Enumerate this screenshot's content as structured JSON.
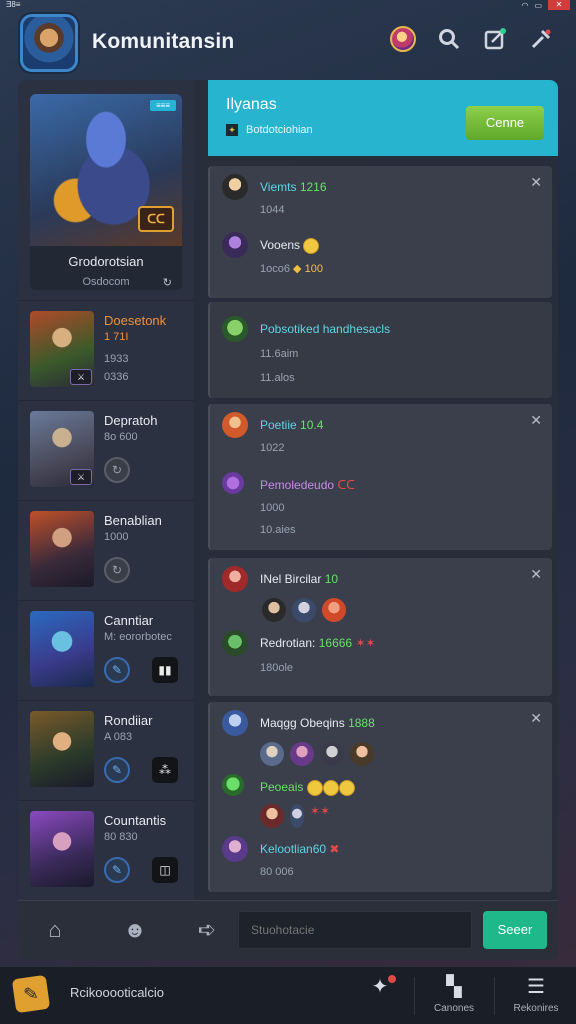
{
  "statusbar": {
    "left": "Ǝ8≡",
    "close": "✕"
  },
  "app": {
    "title": "Komunitansin"
  },
  "feature": {
    "tag": "≡≡≡",
    "badge": "ᑕᑕ",
    "name": "Grodorotsian",
    "sub": "Osdocom"
  },
  "heroes": [
    {
      "name": "Doesetonk",
      "line1": "1 71I",
      "line2": "1933",
      "line3": "0336",
      "mini": "⚔"
    },
    {
      "name": "Depratoh",
      "line1": "8o 600",
      "mini": "⚔"
    },
    {
      "name": "Benablian",
      "line1": "1000"
    },
    {
      "name": "Canntiar",
      "line1": "M: eororbotec"
    },
    {
      "name": "Rondiiar",
      "line1": "A 083"
    },
    {
      "name": "Countantis",
      "line1": "80 830"
    }
  ],
  "room": {
    "title": "Ilyanas",
    "sub": "Botdotciohian",
    "sub_icon": "✦",
    "join_label": "Cenne"
  },
  "cards": [
    {
      "entries": [
        {
          "name": "Viemts",
          "tag": "1216",
          "line": "1044"
        },
        {
          "name": "Vooens",
          "line": "1oco6",
          "extra": "100"
        }
      ]
    },
    {
      "entries": [
        {
          "name": "Pobsotiked  handhesacls",
          "line1": "11.6aim",
          "line2": "11.alos"
        }
      ]
    },
    {
      "entries": [
        {
          "name": "Poetiie",
          "tag": "10.4",
          "line": "1022"
        },
        {
          "name": "Pemoledeudo",
          "tag": "ᑕᑕ",
          "line1": "1000",
          "line2": "10.aies"
        }
      ]
    },
    {
      "entries": [
        {
          "name": "INel Bircilar",
          "tag": "10"
        },
        {
          "name": "Redrotian:",
          "tag": "16666",
          "extra": "✶✶",
          "line": "180ole"
        }
      ]
    },
    {
      "entries": [
        {
          "name": "Maqgg Obeqins",
          "tag": "1888"
        },
        {
          "name": "Peoeais",
          "extra": "✶✶"
        },
        {
          "name": "Kelootlian60",
          "line": "80 006"
        }
      ]
    }
  ],
  "composer": {
    "placeholder": "Stuohotacie",
    "send_label": "Seeer"
  },
  "bottomnav": {
    "label": "Rcikooooticalcio",
    "items": [
      {
        "label": "Canones"
      },
      {
        "label": "Rekonires"
      }
    ]
  },
  "colors": {
    "accent": "#26b4cf",
    "join": "#6eb836",
    "send": "#1fb88a"
  },
  "icons": [
    "search-icon",
    "edit-icon",
    "tools-icon",
    "home-icon",
    "user-icon",
    "message-icon",
    "close-icon",
    "menu-icon"
  ]
}
